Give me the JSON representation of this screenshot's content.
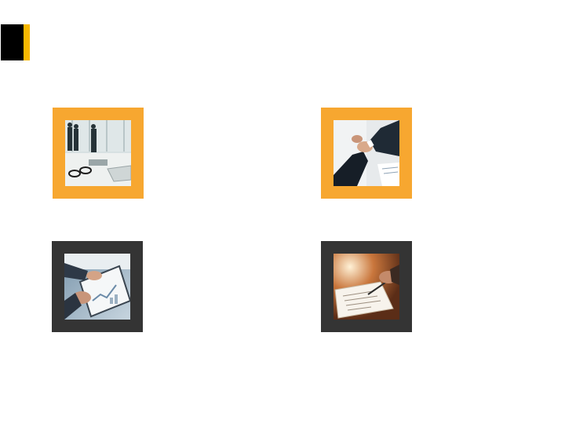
{
  "colors": {
    "accent_bar": "#f8b800",
    "title_block": "#000000",
    "tile_orange": "#f7a730",
    "tile_dark": "#343434"
  },
  "tiles": [
    {
      "frame": "orange",
      "photo": "business-people-office-photo"
    },
    {
      "frame": "orange",
      "photo": "handshake-photo"
    },
    {
      "frame": "dark",
      "photo": "tablet-analytics-photo"
    },
    {
      "frame": "dark",
      "photo": "signing-document-photo"
    }
  ]
}
